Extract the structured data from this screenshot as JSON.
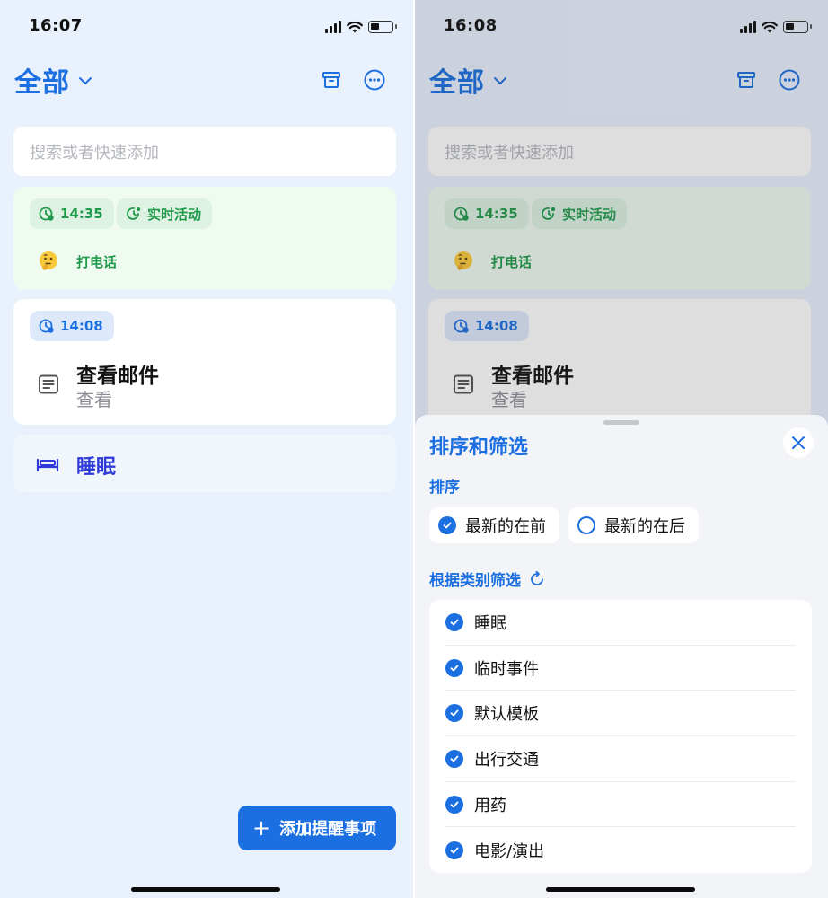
{
  "left": {
    "status": {
      "time": "16:07"
    },
    "header": {
      "title": "全部"
    },
    "search": {
      "placeholder": "搜索或者快速添加"
    },
    "card1": {
      "chip_time": "14:35",
      "chip_live": "实时活动",
      "task": "打电话"
    },
    "card2": {
      "chip_time": "14:08",
      "title": "查看邮件",
      "subtitle": "查看"
    },
    "card3": {
      "title": "睡眠"
    },
    "fab": {
      "label": "添加提醒事项",
      "plus": "+"
    }
  },
  "right": {
    "status": {
      "time": "16:08"
    },
    "header": {
      "title": "全部"
    },
    "search": {
      "placeholder": "搜索或者快速添加"
    },
    "card1": {
      "chip_time": "14:35",
      "chip_live": "实时活动",
      "task": "打电话"
    },
    "card2": {
      "chip_time": "14:08",
      "title": "查看邮件",
      "subtitle": "查看"
    },
    "sheet": {
      "title": "排序和筛选",
      "sort_label": "排序",
      "sort_options": [
        {
          "label": "最新的在前",
          "selected": true
        },
        {
          "label": "最新的在后",
          "selected": false
        }
      ],
      "filter_label": "根据类别筛选",
      "filters": [
        "睡眠",
        "临时事件",
        "默认模板",
        "出行交通",
        "用药",
        "电影/演出"
      ]
    }
  },
  "colors": {
    "accent": "#1b6fe0",
    "green": "#1f9a4a",
    "sleep": "#2f3bd9"
  },
  "icons": [
    "archive-icon",
    "more-icon",
    "chevron-down-icon",
    "clock-icon",
    "live-activity-icon",
    "thinking-face-icon",
    "note-icon",
    "bed-icon",
    "plus-icon",
    "close-icon",
    "refresh-icon",
    "check-icon",
    "signal-icon",
    "wifi-icon",
    "battery-icon"
  ]
}
